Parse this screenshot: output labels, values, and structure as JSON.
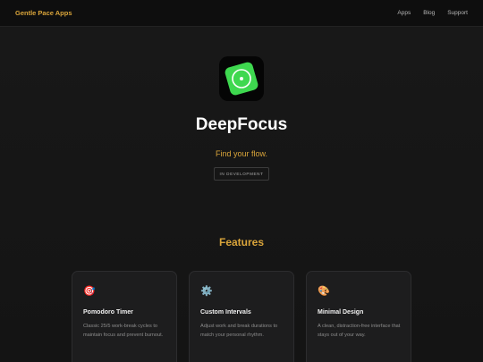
{
  "nav": {
    "brand": "Gentle Pace Apps",
    "links": [
      "Apps",
      "Blog",
      "Support"
    ]
  },
  "hero": {
    "icon": "focus-target-icon",
    "title": "DeepFocus",
    "tagline": "Find your flow.",
    "badge": "IN DEVELOPMENT"
  },
  "features": {
    "heading": "Features",
    "cards": [
      {
        "icon": "target-icon",
        "glyph": "🎯",
        "title": "Pomodoro Timer",
        "desc": "Classic 25/5 work-break cycles to maintain focus and prevent burnout."
      },
      {
        "icon": "gear-icon",
        "glyph": "⚙️",
        "title": "Custom Intervals",
        "desc": "Adjust work and break durations to match your personal rhythm."
      },
      {
        "icon": "palette-icon",
        "glyph": "🎨",
        "title": "Minimal Design",
        "desc": "A clean, distraction-free interface that stays out of your way."
      }
    ]
  },
  "colors": {
    "accent": "#d9a43a",
    "background": "#141414",
    "icon_green": "#3ed84f"
  }
}
